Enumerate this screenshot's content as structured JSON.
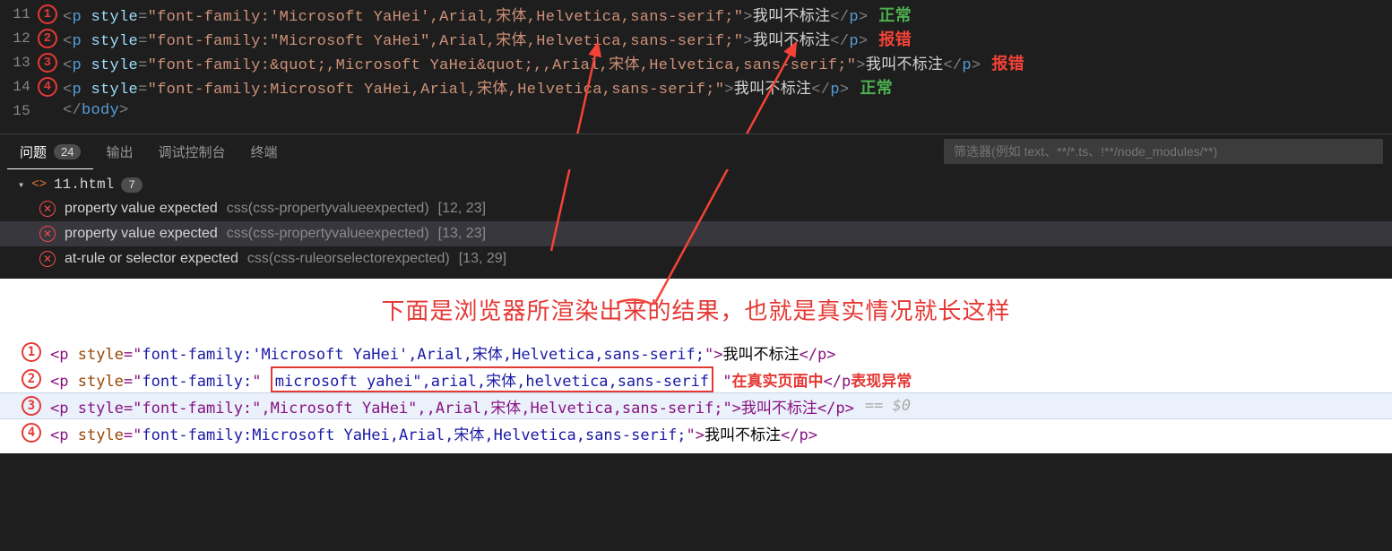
{
  "editor": {
    "lines": [
      {
        "num": "11",
        "circ": "1",
        "prefix": "<p ",
        "attr": "style",
        "val": "\"font-family:'Microsoft YaHei',Arial,宋体,Helvetica,sans-serif;\"",
        "close": ">",
        "text": "我叫不标注",
        "endtag": "</p>",
        "status": "正常",
        "ok": true
      },
      {
        "num": "12",
        "circ": "2",
        "prefix": "<p ",
        "attr": "style",
        "val": "\"font-family:\"Microsoft YaHei\",Arial,宋体,Helvetica,sans-serif;\"",
        "close": ">",
        "text": "我叫不标注",
        "endtag": "</p>",
        "status": "报错",
        "ok": false
      },
      {
        "num": "13",
        "circ": "3",
        "prefix": "<p ",
        "attr": "style",
        "val": "\"font-family:&quot;,Microsoft YaHei&quot;,,Arial,宋体,Helvetica,sans-serif;\"",
        "close": ">",
        "text": "我叫不标注",
        "endtag": "</p>",
        "status": "报错",
        "ok": false
      },
      {
        "num": "14",
        "circ": "4",
        "prefix": "<p ",
        "attr": "style",
        "val": "\"font-family:Microsoft YaHei,Arial,宋体,Helvetica,sans-serif;\"",
        "close": ">",
        "text": "我叫不标注",
        "endtag": "</p>",
        "status": "正常",
        "ok": true
      },
      {
        "num": "15",
        "circ": "",
        "body": "</body>"
      }
    ]
  },
  "panel": {
    "tabs": [
      {
        "label": "问题",
        "badge": "24",
        "active": true
      },
      {
        "label": "输出"
      },
      {
        "label": "调试控制台"
      },
      {
        "label": "终端"
      }
    ],
    "filter_placeholder": "筛选器(例如 text、**/*.ts、!**/node_modules/**)",
    "file": {
      "name": "11.html",
      "count": "7"
    },
    "problems": [
      {
        "msg": "property value expected",
        "src": "css(css-propertyvalueexpected)",
        "loc": "[12, 23]"
      },
      {
        "msg": "property value expected",
        "src": "css(css-propertyvalueexpected)",
        "loc": "[13, 23]",
        "hl": true
      },
      {
        "msg": "at-rule or selector expected",
        "src": "css(css-ruleorselectorexpected)",
        "loc": "[13, 29]"
      }
    ]
  },
  "browser": {
    "title": "下面是浏览器所渲染出来的结果，也就是真实情况就长这样",
    "lines": [
      {
        "circ": "1",
        "html": "<p style=\"font-family:'Microsoft YaHei',Arial,宋体,Helvetica,sans-serif;\">我叫不标注</p>"
      },
      {
        "circ": "2",
        "prefix": "<p style=\"font-family:\" ",
        "boxed": "microsoft yahei\",arial,宋体,helvetica,sans-serif",
        "suffix": "\"",
        "note1": "在真实页面中",
        "mid": "</p",
        "note2": "表现异常"
      },
      {
        "circ": "3",
        "html": "<p style=\"font-family:\",Microsoft YaHei\",,Arial,宋体,Helvetica,sans-serif;\">我叫不标注</p>",
        "sel": true,
        "eq": "== $0"
      },
      {
        "circ": "4",
        "html": "<p style=\"font-family:Microsoft YaHei,Arial,宋体,Helvetica,sans-serif;\">我叫不标注</p>"
      }
    ]
  }
}
